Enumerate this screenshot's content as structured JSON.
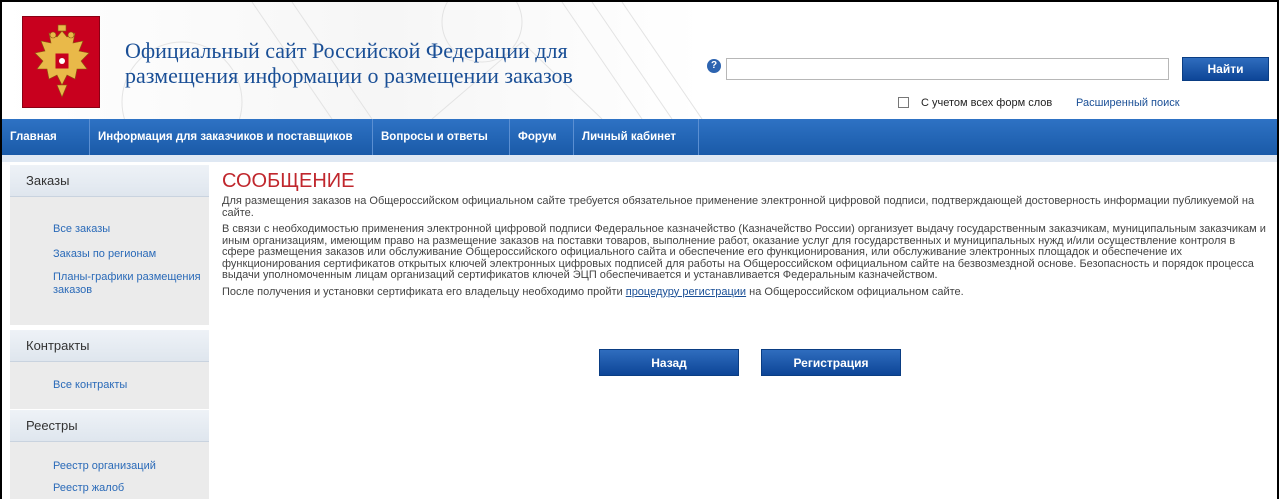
{
  "header": {
    "title_line1": "Официальный сайт Российской Федерации для",
    "title_line2": "размещения информации о размещении заказов",
    "help_icon": "?",
    "search_value": "",
    "search_button": "Найти",
    "wordforms_label": "С учетом всех форм слов",
    "advanced_search": "Расширенный поиск"
  },
  "nav": {
    "items": [
      "Главная",
      "Информация для заказчиков и поставщиков",
      "Вопросы и ответы",
      "Форум",
      "Личный кабинет"
    ]
  },
  "sidebar": {
    "sections": [
      {
        "title": "Заказы",
        "links": [
          "Все заказы",
          "Заказы по регионам",
          "Планы-графики размещения",
          "заказов"
        ]
      },
      {
        "title": "Контракты",
        "links": [
          "Все контракты"
        ]
      },
      {
        "title": "Реестры",
        "links": [
          "Реестр организаций",
          "Реестр жалоб"
        ]
      }
    ]
  },
  "main": {
    "title": "СООБЩЕНИЕ",
    "para1": "Для размещения заказов на Общероссийском официальном сайте требуется обязательное применение электронной цифровой подписи, подтверждающей достоверность информации публикуемой на сайте.",
    "para2": "В связи с необходимостью применения электронной цифровой подписи Федеральное казначейство (Казначейство России) организует выдачу государственным заказчикам, муниципальным заказчикам и иным организациям, имеющим право на размещение заказов на поставки товаров, выполнение работ, оказание услуг для государственных и муниципальных нужд и/или осуществление контроля в сфере размещения заказов или обслуживание Общероссийского официального сайта и обеспечение его функционирования, или обслуживание электронных площадок и обеспечение их функционирования сертификатов открытых ключей электронных цифровых подписей для работы на Общероссийском официальном сайте на безвозмездной основе. Безопасность и порядок процесса выдачи уполномоченным лицам организаций сертификатов ключей ЭЦП обеспечивается и устанавливается Федеральным казначейством.",
    "para3_before": "После получения и установки сертификата его владельцу необходимо пройти ",
    "para3_link": "процедуру регистрации",
    "para3_after": " на Общероссийском официальном сайте.",
    "back_button": "Назад",
    "register_button": "Регистрация"
  },
  "colors": {
    "nav_blue": "#1a5aa8",
    "title_red": "#c0272d",
    "link_blue": "#2a6ab8",
    "emblem_red": "#c8001e"
  },
  "icons": {
    "emblem": "russian-coat-of-arms",
    "help": "help-icon",
    "checkbox": "checkbox-icon"
  }
}
